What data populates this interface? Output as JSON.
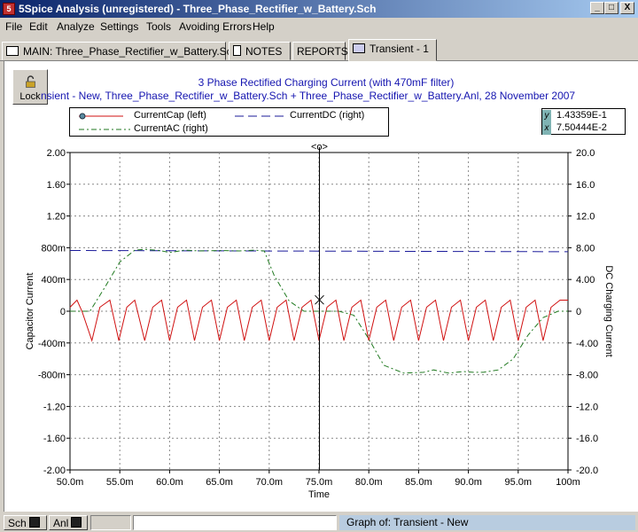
{
  "window": {
    "title": "5Spice Analysis (unregistered) - Three_Phase_Rectifier_w_Battery.Sch",
    "app_icon": "5",
    "minimize": "_",
    "maximize": "□",
    "close": "X"
  },
  "menu": [
    "File",
    "Edit",
    "Analyze",
    "Settings",
    "Tools",
    "Avoiding Errors",
    "Help"
  ],
  "tabs": [
    {
      "label": "MAIN:  Three_Phase_Rectifier_w_Battery.Sch",
      "icon": "schematic-icon"
    },
    {
      "label": "NOTES",
      "icon": "notepad-icon"
    },
    {
      "label": "REPORTS",
      "icon": ""
    },
    {
      "label": "Transient - 1",
      "icon": "graph-icon"
    }
  ],
  "lock_label": "Lock",
  "graph": {
    "title": "3 Phase Rectified Charging Current (with 470mF filter)",
    "subtitle": "nsient - New,    Three_Phase_Rectifier_w_Battery.Sch + Three_Phase_Rectifier_w_Battery.Anl,   28 November 2007",
    "cursor_label": "<o>"
  },
  "legend": {
    "current_cap": "CurrentCap (left)",
    "current_dc": "CurrentDC (right)",
    "current_ac": "CurrentAC (right)"
  },
  "readout": {
    "y_label": "y",
    "y_value": "1.43359E-1",
    "x_label": "x",
    "x_value": "7.50444E-2"
  },
  "status": {
    "sch": "Sch",
    "anl": "Anl",
    "graph_of": "Graph of:  Transient - New"
  },
  "colors": {
    "current_cap": "#d01010",
    "current_dc": "#1a1a9a",
    "current_ac": "#207a20",
    "title": "#1515b0"
  },
  "chart_data": {
    "type": "line",
    "xlabel": "Time",
    "ylabel_left": "Capacitor Current",
    "ylabel_right": "DC Charging Current",
    "x_ticks": [
      "50.0m",
      "55.0m",
      "60.0m",
      "65.0m",
      "70.0m",
      "75.0m",
      "80.0m",
      "85.0m",
      "90.0m",
      "95.0m",
      "100m"
    ],
    "y_left_ticks": [
      "2.00",
      "1.60",
      "1.20",
      "800m",
      "400m",
      "0",
      "-400m",
      "-800m",
      "-1.20",
      "-1.60",
      "-2.00"
    ],
    "y_right_ticks": [
      "20.0",
      "16.0",
      "12.0",
      "8.00",
      "4.00",
      "0",
      "-4.00",
      "-8.00",
      "-12.0",
      "-16.0",
      "-20.0"
    ],
    "xlim": [
      0.05,
      0.1
    ],
    "ylim_left": [
      -2.0,
      2.0
    ],
    "ylim_right": [
      -20.0,
      20.0
    ],
    "grid": true,
    "cursor_x": 0.0750444,
    "cursor_y_left": 0.143359,
    "series": [
      {
        "name": "CurrentCap (left)",
        "axis": "left",
        "x": [
          0.05,
          0.0507,
          0.0512,
          0.0522,
          0.053,
          0.054,
          0.0549,
          0.0557,
          0.0565,
          0.0575,
          0.0583,
          0.0592,
          0.06,
          0.0608,
          0.0617,
          0.0625,
          0.0633,
          0.0642,
          0.065,
          0.0658,
          0.0667,
          0.0675,
          0.0683,
          0.0692,
          0.07,
          0.0708,
          0.0717,
          0.0725,
          0.0733,
          0.0742,
          0.075,
          0.0758,
          0.0767,
          0.0775,
          0.0783,
          0.0792,
          0.08,
          0.0808,
          0.0817,
          0.0825,
          0.0833,
          0.0842,
          0.085,
          0.0858,
          0.0867,
          0.0875,
          0.0883,
          0.0892,
          0.09,
          0.0908,
          0.0917,
          0.0925,
          0.0933,
          0.0942,
          0.095,
          0.0958,
          0.0967,
          0.0975,
          0.0983,
          0.0992,
          0.1
        ],
        "y": [
          0.05,
          0.14,
          0.0,
          -0.37,
          0.05,
          0.14,
          -0.37,
          0.05,
          0.14,
          -0.37,
          0.05,
          0.14,
          -0.37,
          0.05,
          0.14,
          -0.37,
          0.05,
          0.14,
          -0.37,
          0.05,
          0.14,
          -0.37,
          0.05,
          0.14,
          -0.37,
          0.05,
          0.14,
          -0.37,
          0.05,
          0.14,
          -0.37,
          0.05,
          0.14,
          -0.37,
          0.05,
          0.14,
          -0.37,
          0.05,
          0.14,
          -0.37,
          0.05,
          0.14,
          -0.37,
          0.05,
          0.14,
          -0.37,
          0.05,
          0.14,
          -0.37,
          0.05,
          0.14,
          -0.37,
          0.05,
          0.14,
          -0.37,
          0.05,
          0.14,
          -0.37,
          0.05,
          0.14,
          0.14
        ]
      },
      {
        "name": "CurrentDC (right)",
        "axis": "right",
        "x": [
          0.05,
          0.1
        ],
        "y": [
          7.65,
          7.5
        ]
      },
      {
        "name": "CurrentAC (right)",
        "axis": "right",
        "x": [
          0.05,
          0.051,
          0.052,
          0.0535,
          0.055,
          0.0565,
          0.0575,
          0.059,
          0.06,
          0.0615,
          0.063,
          0.065,
          0.067,
          0.0685,
          0.0695,
          0.0705,
          0.072,
          0.0735,
          0.075,
          0.077,
          0.0785,
          0.08,
          0.0815,
          0.0835,
          0.0855,
          0.0865,
          0.088,
          0.0895,
          0.0905,
          0.0915,
          0.093,
          0.0945,
          0.096,
          0.0975,
          0.099,
          0.1
        ],
        "y": [
          0.0,
          0.0,
          0.0,
          3.0,
          6.2,
          7.7,
          7.8,
          7.65,
          7.4,
          7.7,
          7.6,
          7.65,
          7.6,
          7.7,
          7.6,
          4.5,
          1.3,
          0.0,
          0.0,
          0.0,
          -0.5,
          -3.5,
          -6.8,
          -7.8,
          -7.7,
          -7.4,
          -7.8,
          -7.6,
          -7.7,
          -7.7,
          -7.4,
          -6.0,
          -3.0,
          -0.8,
          0.0,
          0.0
        ]
      }
    ]
  }
}
